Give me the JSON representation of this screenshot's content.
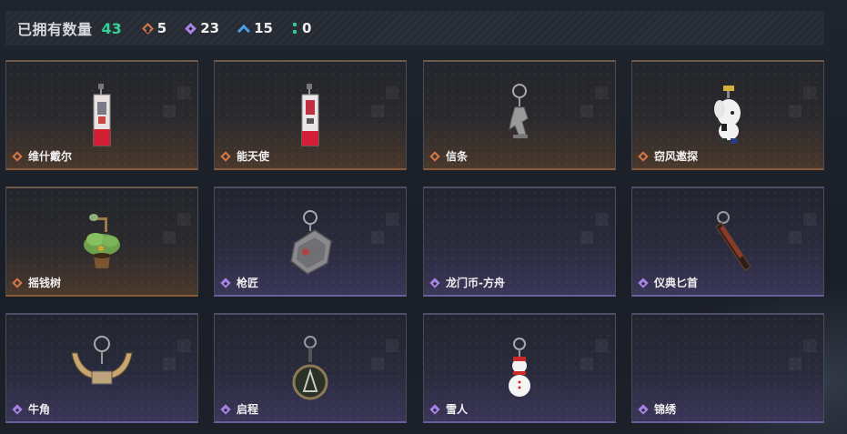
{
  "header": {
    "owned_label": "已拥有数量",
    "owned_total": "43",
    "counters": [
      {
        "icon": "orange-diamond-icon",
        "value": "5",
        "color": "#d9794a"
      },
      {
        "icon": "purple-diamond-icon",
        "value": "23",
        "color": "#a883e6"
      },
      {
        "icon": "blue-chevron-icon",
        "value": "15",
        "color": "#4d9de8"
      },
      {
        "icon": "green-dots-icon",
        "value": "0",
        "color": "#2fc7a0"
      }
    ]
  },
  "items": [
    {
      "name": "维什戴尔",
      "rarity": "orange",
      "icon": "lighter-charm-icon"
    },
    {
      "name": "能天使",
      "rarity": "orange",
      "icon": "lighter-charm-icon"
    },
    {
      "name": "信条",
      "rarity": "orange",
      "icon": "silver-figure-charm-icon"
    },
    {
      "name": "窃风邀探",
      "rarity": "orange",
      "icon": "white-plush-charm-icon"
    },
    {
      "name": "摇钱树",
      "rarity": "orange",
      "icon": "money-tree-charm-icon"
    },
    {
      "name": "枪匠",
      "rarity": "purple",
      "icon": "dog-tag-charm-icon"
    },
    {
      "name": "龙门币-方舟",
      "rarity": "purple",
      "icon": "empty"
    },
    {
      "name": "仪典匕首",
      "rarity": "purple",
      "icon": "dagger-charm-icon"
    },
    {
      "name": "牛角",
      "rarity": "purple",
      "icon": "horns-charm-icon"
    },
    {
      "name": "启程",
      "rarity": "purple",
      "icon": "medallion-charm-icon"
    },
    {
      "name": "雪人",
      "rarity": "purple",
      "icon": "snowman-charm-icon"
    },
    {
      "name": "锦绣",
      "rarity": "purple",
      "icon": "empty"
    }
  ]
}
